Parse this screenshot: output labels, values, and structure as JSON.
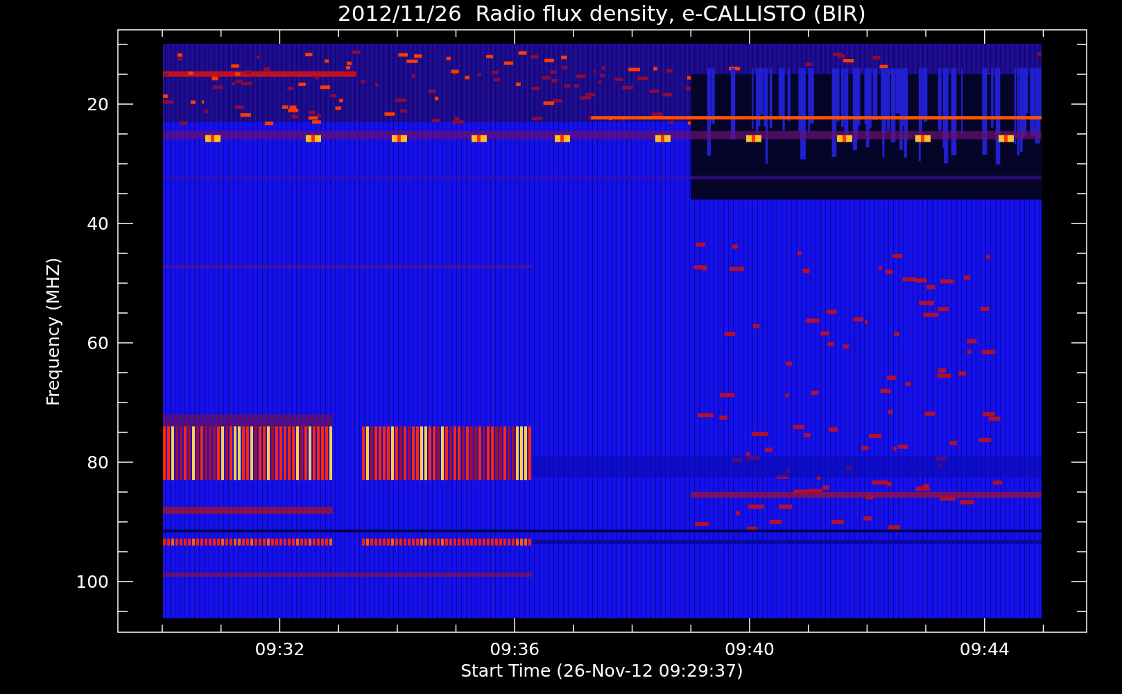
{
  "chart": {
    "title": "2012/11/26  Radio flux density, e-CALLISTO (BIR)",
    "xlabel": "Start Time (26-Nov-12 09:29:37)",
    "ylabel": "Frequency (MHZ)",
    "y_tick_labels": [
      "20",
      "40",
      "60",
      "80",
      "100"
    ],
    "x_tick_labels": [
      "09:32",
      "09:36",
      "09:40",
      "09:44"
    ]
  }
}
